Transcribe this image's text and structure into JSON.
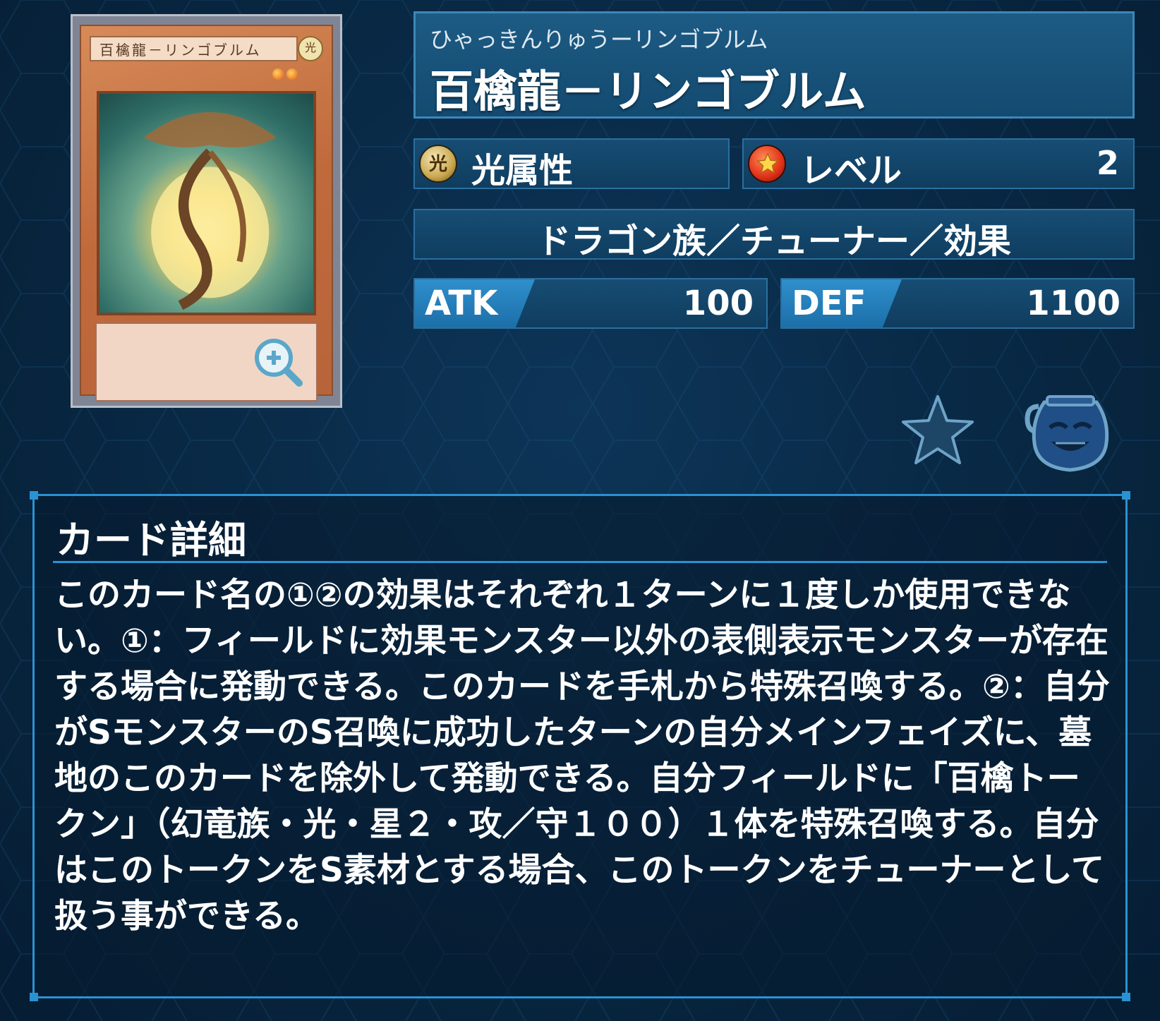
{
  "card": {
    "ruby": "ひゃっきんりゅうーリンゴブルム",
    "name": "百檎龍－リンゴブルム",
    "attribute_icon_glyph": "光",
    "attribute": "光属性",
    "level_label": "レベル",
    "level": "2",
    "type_line": "ドラゴン族／チューナー／効果",
    "atk_label": "ATK",
    "atk": "100",
    "def_label": "DEF",
    "def": "1100"
  },
  "card_image": {
    "name_text": "百檎龍－リンゴブルム",
    "attribute_glyph": "光"
  },
  "icons": {
    "zoom": "zoom-in-icon",
    "favorite": "star-icon",
    "pot": "pot-of-greed-icon",
    "attribute": "light-attribute-icon",
    "level": "level-star-icon"
  },
  "details": {
    "heading": "カード詳細",
    "text": "このカード名の①②の効果はそれぞれ１ターンに１度しか使用できない。①：フィールドに効果モンスター以外の表側表示モンスターが存在する場合に発動できる。このカードを手札から特殊召喚する。②：自分がSモンスターのS召喚に成功したターンの自分メインフェイズに、墓地のこのカードを除外して発動できる。自分フィールドに「百檎トークン」（幻竜族・光・星２・攻／守１００）１体を特殊召喚する。自分はこのトークンをS素材とする場合、このトークンをチューナーとして扱う事ができる。"
  },
  "colors": {
    "background": "#082742",
    "panel": "#134a70",
    "accent": "#2a92d3"
  }
}
